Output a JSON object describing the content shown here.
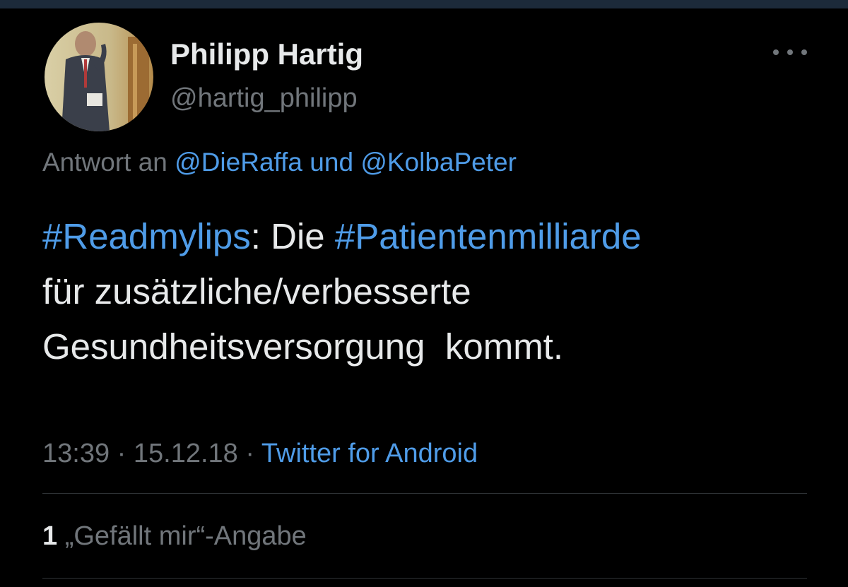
{
  "author": {
    "name": "Philipp Hartig",
    "handle": "@hartig_philipp"
  },
  "reply": {
    "prefix": "Antwort an",
    "mention1": "@DieRaffa",
    "connector": "und",
    "mention2": "@KolbaPeter"
  },
  "tweet": {
    "hashtag1": "#Readmylips",
    "text_after_hashtag1": ": Die ",
    "hashtag2": "#Patientenmilliarde",
    "line2": "für zusätzliche/verbesserte",
    "line3": "Gesundheitsversorgung  kommt."
  },
  "meta": {
    "time": "13:39",
    "separator": "·",
    "date": "15.12.18",
    "source": "Twitter for Android"
  },
  "likes": {
    "count": "1",
    "label": "„Gefällt mir“-Angabe"
  },
  "colors": {
    "background": "#000000",
    "primary_text": "#e7e9ea",
    "secondary_text": "#71767b",
    "link": "#4f9ce8",
    "divider": "#2f3336"
  },
  "icons": {
    "more": "more-horizontal-icon"
  }
}
